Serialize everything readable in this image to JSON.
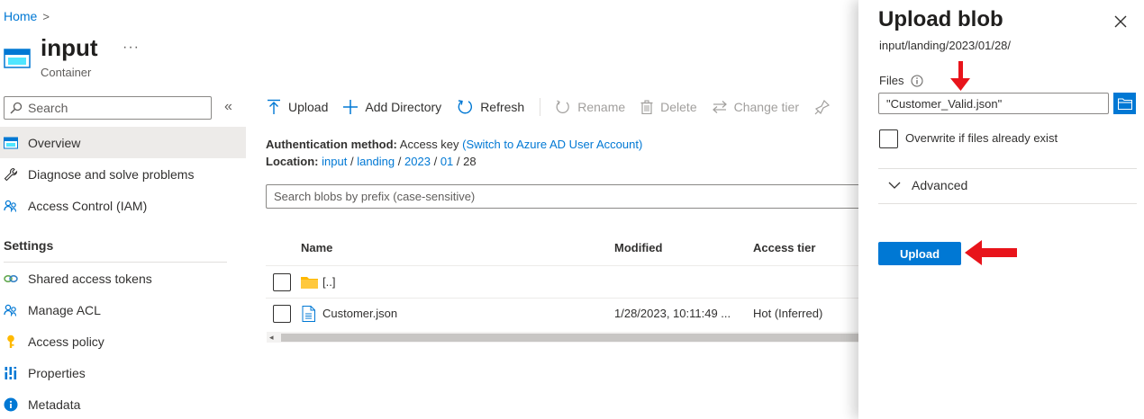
{
  "breadcrumb": {
    "home": "Home",
    "separator": ">"
  },
  "resource": {
    "title": "input",
    "subtitle": "Container",
    "more": "···"
  },
  "sidebar": {
    "search_placeholder": "Search",
    "collapse": "«",
    "items": [
      {
        "label": "Overview",
        "icon": "overview-icon"
      },
      {
        "label": "Diagnose and solve problems",
        "icon": "wrench-icon"
      },
      {
        "label": "Access Control (IAM)",
        "icon": "people-icon"
      }
    ],
    "settings_heading": "Settings",
    "settings_items": [
      {
        "label": "Shared access tokens",
        "icon": "link-icon"
      },
      {
        "label": "Manage ACL",
        "icon": "people-icon"
      },
      {
        "label": "Access policy",
        "icon": "key-icon"
      },
      {
        "label": "Properties",
        "icon": "properties-icon"
      },
      {
        "label": "Metadata",
        "icon": "info-icon"
      }
    ]
  },
  "toolbar": {
    "upload": "Upload",
    "add_directory": "Add Directory",
    "refresh": "Refresh",
    "rename": "Rename",
    "delete": "Delete",
    "change_tier": "Change tier"
  },
  "info": {
    "auth_label": "Authentication method:",
    "auth_value": "Access key",
    "auth_link": "(Switch to Azure AD User Account)",
    "location_label": "Location:",
    "path": [
      "input",
      "landing",
      "2023",
      "01",
      "28"
    ],
    "path_sep": "/"
  },
  "blob_search": {
    "placeholder": "Search blobs by prefix (case-sensitive)"
  },
  "table": {
    "columns": [
      "Name",
      "Modified",
      "Access tier"
    ],
    "rows": [
      {
        "name": "[..]",
        "modified": "",
        "tier": "",
        "icon": "folder-icon"
      },
      {
        "name": "Customer.json",
        "modified": "1/28/2023, 10:11:49 ...",
        "tier": "Hot (Inferred)",
        "icon": "file-icon"
      }
    ]
  },
  "panel": {
    "title": "Upload blob",
    "path": "input/landing/2023/01/28/",
    "files_label": "Files",
    "files_value": "\"Customer_Valid.json\"",
    "overwrite_label": "Overwrite if files already exist",
    "advanced_label": "Advanced",
    "upload_button": "Upload"
  },
  "colors": {
    "accent": "#0078d4",
    "annotation_arrow": "#e8141b"
  }
}
